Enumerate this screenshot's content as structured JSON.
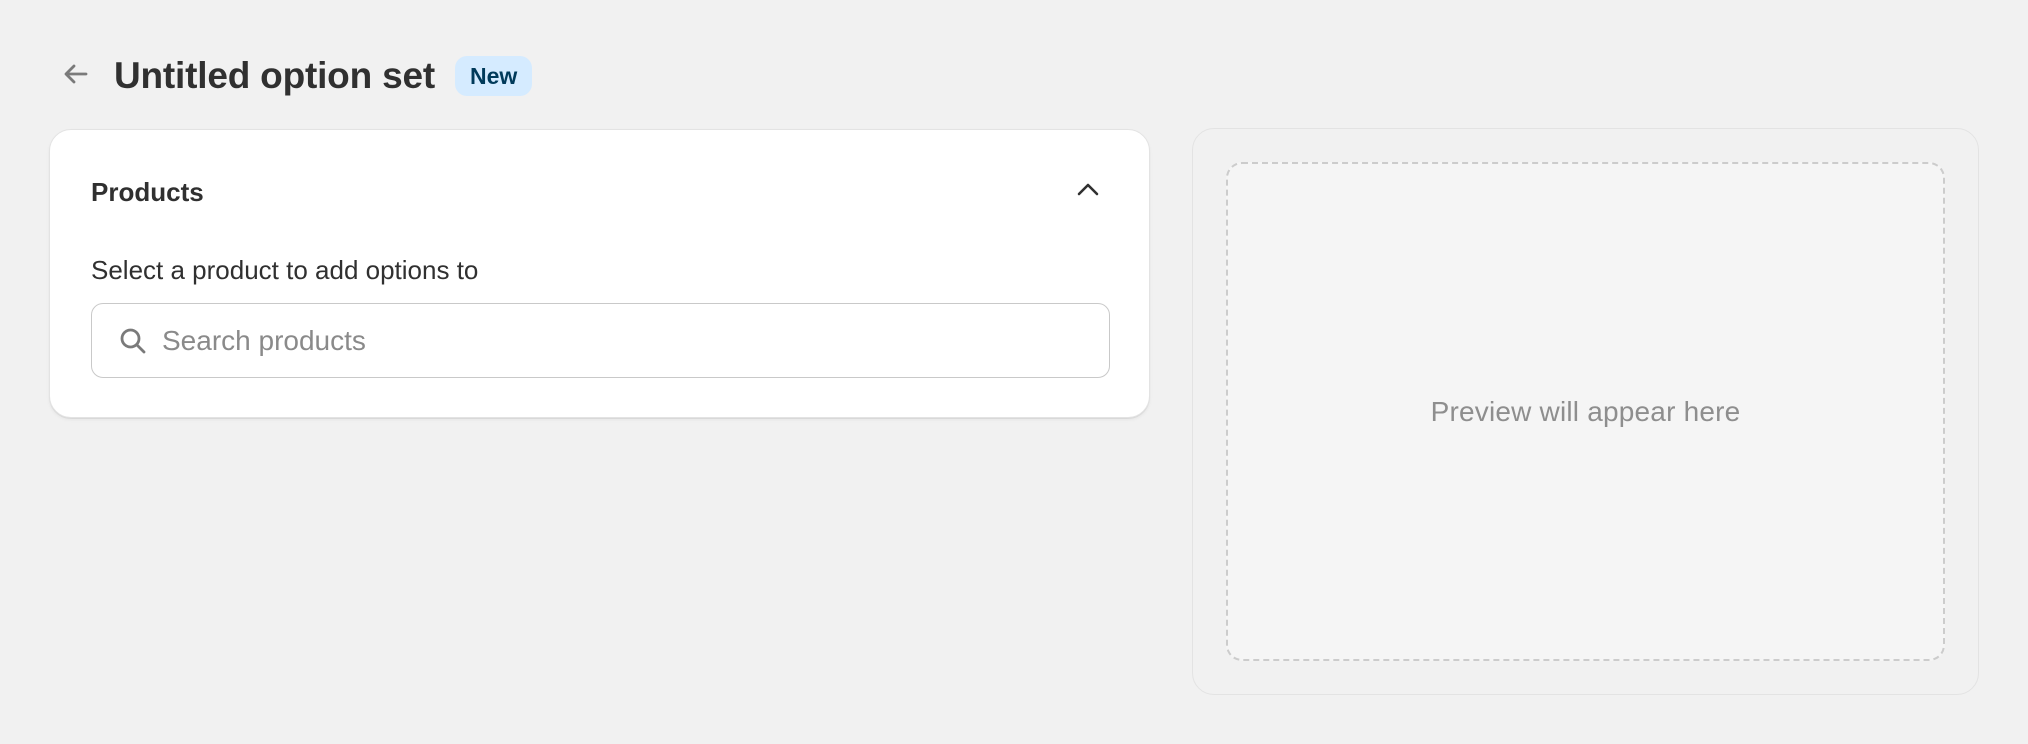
{
  "header": {
    "back_icon": "arrow-left-icon",
    "title": "Untitled option set",
    "badge": "New"
  },
  "products_card": {
    "title": "Products",
    "collapse_icon": "chevron-up-icon",
    "field_label": "Select a product to add options to",
    "search": {
      "icon": "search-icon",
      "placeholder": "Search products",
      "value": ""
    }
  },
  "preview": {
    "placeholder_text": "Preview will appear here"
  },
  "colors": {
    "background": "#f1f1f1",
    "card": "#ffffff",
    "badge_bg": "#d5ebff",
    "badge_text": "#003a5a",
    "text": "#303030",
    "muted_text": "#8e8e8e"
  }
}
